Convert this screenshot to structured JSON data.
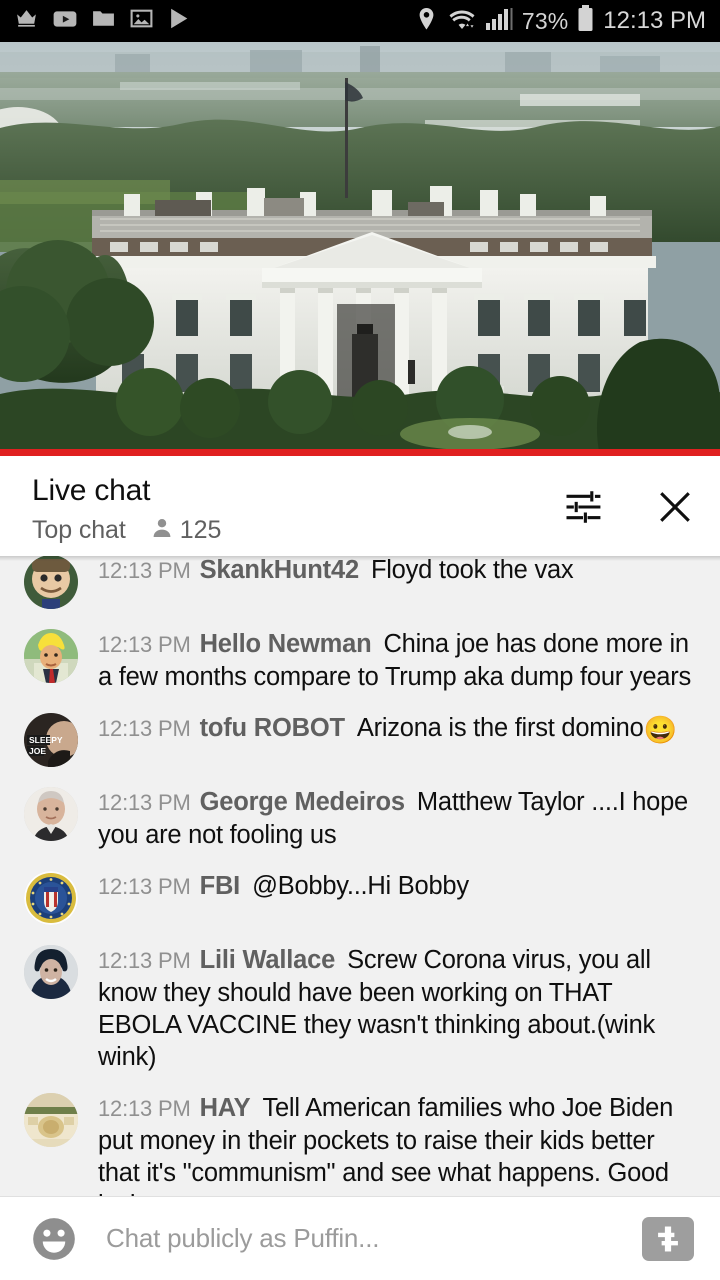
{
  "status_bar": {
    "left_icons": [
      "crown-icon",
      "youtube-icon",
      "folder-icon",
      "photo-icon",
      "play-store-icon"
    ],
    "location_icon": "location-pin-icon",
    "wifi_icon": "wifi-icon",
    "signal_icon": "cellular-signal-icon",
    "battery_percent": "73%",
    "battery_icon": "battery-icon",
    "time": "12:13 PM"
  },
  "video": {
    "label": "white-house-live-stream",
    "progress_percent": 100,
    "progress_color": "#e02020"
  },
  "chat_header": {
    "title": "Live chat",
    "mode": "Top chat",
    "viewer_count": "125",
    "viewer_icon": "person-icon",
    "settings_icon": "chat-settings-icon",
    "close_icon": "close-icon"
  },
  "messages": [
    {
      "time": "12:13 PM",
      "author": "SkankHunt42",
      "text": "Floyd took the vax",
      "avatar": "skankhunt42-avatar",
      "clipped": true
    },
    {
      "time": "12:13 PM",
      "author": "Hello Newman",
      "text": "China joe has done more in a few months compare to Trump aka dump four years",
      "avatar": "hello-newman-avatar"
    },
    {
      "time": "12:13 PM",
      "author": "tofu ROBOT",
      "text": "Arizona is the first domino",
      "emoji": "😀",
      "avatar": "tofu-robot-avatar"
    },
    {
      "time": "12:13 PM",
      "author": "George Medeiros",
      "text": "Matthew Taylor ....I hope you are not fooling us",
      "avatar": "george-medeiros-avatar"
    },
    {
      "time": "12:13 PM",
      "author": "FBI",
      "text": "@Bobby...Hi Bobby",
      "avatar": "fbi-avatar"
    },
    {
      "time": "12:13 PM",
      "author": "Lili Wallace",
      "text": "Screw Corona virus, you all know they should have been working on THAT EBOLA VACCINE they wasn't thinking about.(wink wink)",
      "avatar": "lili-wallace-avatar"
    },
    {
      "time": "12:13 PM",
      "author": "HAY",
      "text": "Tell American families who Joe Biden put money in their pockets to raise their kids better that it's \"communism\" and see what happens. Good luck",
      "avatar": "hay-avatar"
    }
  ],
  "input_bar": {
    "emoji_icon": "emoji-smiley-icon",
    "placeholder": "Chat publicly as Puffin...",
    "value": "",
    "superchat_icon": "super-chat-dollar-icon"
  },
  "colors": {
    "chat_background": "#f1f1f1",
    "header_background": "#ffffff",
    "author_text": "#606060",
    "timestamp_text": "#909090",
    "message_text": "#0f0f0f",
    "status_bar": "#000000",
    "progress_red": "#e02020"
  }
}
